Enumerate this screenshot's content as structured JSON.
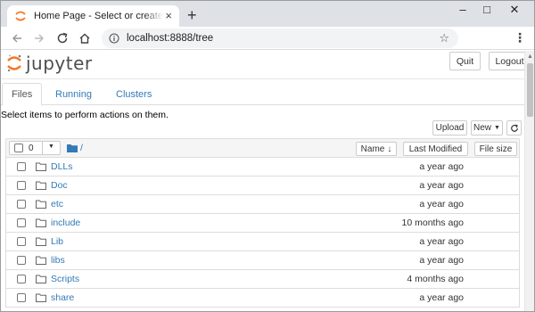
{
  "browser": {
    "tab_title": "Home Page - Select or create a n",
    "tab_close": "×",
    "new_tab": "+",
    "url": "localhost:8888/tree",
    "controls": {
      "minimize": "–",
      "maximize": "□",
      "close": "✕"
    },
    "favicon": "jupyter-favicon",
    "colors": {
      "tabbar": "#dee1e6",
      "omnibox": "#f1f3f4"
    }
  },
  "header": {
    "logo_text": "jupyter",
    "quit_label": "Quit",
    "logout_label": "Logout"
  },
  "tabs": [
    {
      "label": "Files",
      "active": true
    },
    {
      "label": "Running",
      "active": false
    },
    {
      "label": "Clusters",
      "active": false
    }
  ],
  "instructions": "Select items to perform actions on them.",
  "actions": {
    "upload_label": "Upload",
    "new_label": "New",
    "refresh_icon": "refresh-icon"
  },
  "list_header": {
    "selected_count": "0",
    "breadcrumb_root": "/",
    "sort_name_label": "Name",
    "last_modified_label": "Last Modified",
    "file_size_label": "File size"
  },
  "files": [
    {
      "name": "DLLs",
      "modified": "a year ago"
    },
    {
      "name": "Doc",
      "modified": "a year ago"
    },
    {
      "name": "etc",
      "modified": "a year ago"
    },
    {
      "name": "include",
      "modified": "10 months ago"
    },
    {
      "name": "Lib",
      "modified": "a year ago"
    },
    {
      "name": "libs",
      "modified": "a year ago"
    },
    {
      "name": "Scripts",
      "modified": "4 months ago"
    },
    {
      "name": "share",
      "modified": "a year ago"
    }
  ],
  "colors": {
    "link": "#337ab7",
    "jupyter_orange": "#f37626",
    "folder": "#666666"
  }
}
